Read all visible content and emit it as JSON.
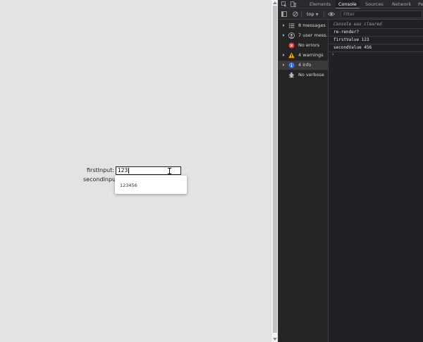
{
  "page": {
    "first_input_label": "firstInput:",
    "first_input_value": "123",
    "second_input_label": "secondInpu",
    "autocomplete_suggestion": "123456"
  },
  "devtools": {
    "tabs": [
      "Elements",
      "Console",
      "Sources",
      "Network",
      "Pe"
    ],
    "active_tab": "Console",
    "context": "top",
    "filter_placeholder": "Filter",
    "sidebar": [
      {
        "label": "8 messages",
        "icon": "list-icon",
        "expandable": true,
        "selected": false
      },
      {
        "label": "7 user mess…",
        "icon": "user-icon",
        "expandable": true,
        "selected": false
      },
      {
        "label": "No errors",
        "icon": "error-icon",
        "expandable": false,
        "selected": false
      },
      {
        "label": "4 warnings",
        "icon": "warning-icon",
        "expandable": true,
        "selected": false
      },
      {
        "label": "4 info",
        "icon": "info-icon",
        "expandable": true,
        "selected": true
      },
      {
        "label": "No verbose",
        "icon": "bug-icon",
        "expandable": false,
        "selected": false
      }
    ],
    "console_lines": [
      "Console was cleared",
      "re-render?",
      "firstValue 123",
      "secondValue 456"
    ],
    "prompt_symbol": "›"
  },
  "colors": {
    "page_bg": "#e4e2e5",
    "devtools_bg": "#242424",
    "accent_blue": "#4d90fe",
    "error_red": "#e53935",
    "warning_yellow": "#f9ab00",
    "info_blue": "#3b78e7"
  }
}
